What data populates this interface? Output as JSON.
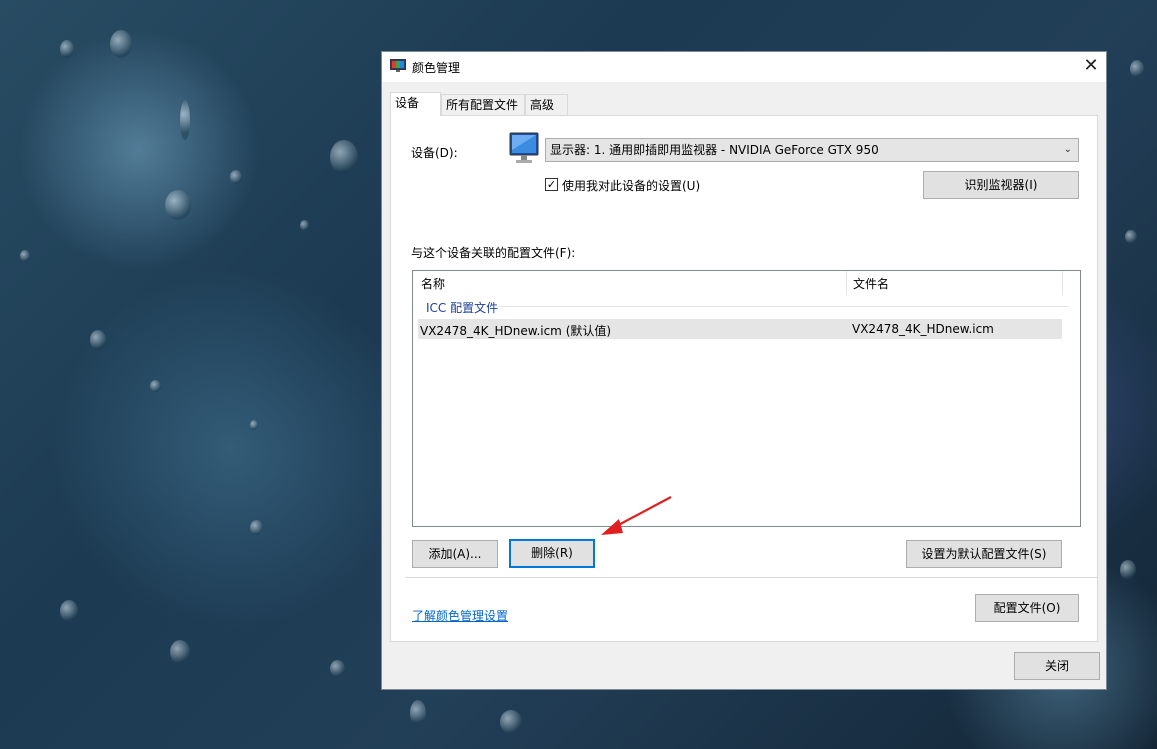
{
  "window": {
    "title": "颜色管理",
    "close_glyph": "✕"
  },
  "tabs": [
    {
      "label": "设备",
      "active": true
    },
    {
      "label": "所有配置文件",
      "active": false
    },
    {
      "label": "高级",
      "active": false
    }
  ],
  "device": {
    "label": "设备(D):",
    "selected": "显示器: 1. 通用即插即用监视器 - NVIDIA GeForce GTX 950",
    "use_my_settings_label": "使用我对此设备的设置(U)",
    "use_my_settings_checked": true,
    "identify_button": "识别监视器(I)"
  },
  "profiles": {
    "section_label": "与这个设备关联的配置文件(F):",
    "columns": [
      "名称",
      "文件名"
    ],
    "group": "ICC 配置文件",
    "rows": [
      {
        "name": "VX2478_4K_HDnew.icm (默认值)",
        "filename": "VX2478_4K_HDnew.icm"
      }
    ],
    "add_button": "添加(A)...",
    "remove_button": "删除(R)",
    "set_default_button": "设置为默认配置文件(S)"
  },
  "footer": {
    "learn_link": "了解颜色管理设置",
    "profiles_button": "配置文件(O)",
    "close_button": "关闭"
  },
  "icons": {
    "title": "color-management-icon",
    "device": "monitor-icon",
    "annotation": "red-arrow-icon"
  },
  "colors": {
    "accent": "#0078d7",
    "link": "#0066cc",
    "group": "#1e3f9c",
    "annotation": "#e02020"
  }
}
